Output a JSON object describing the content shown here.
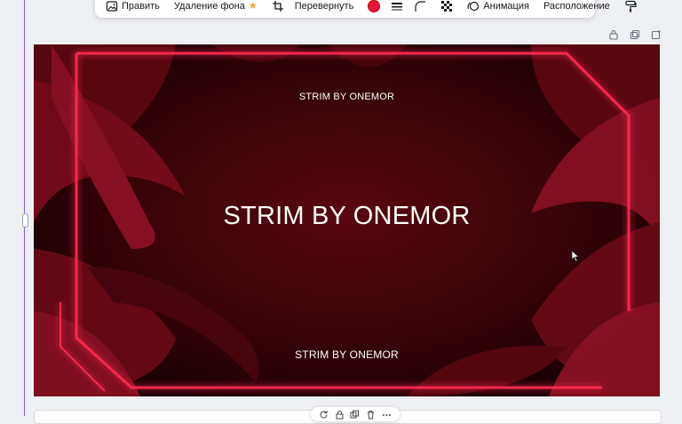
{
  "toolbar": {
    "edit_label": "Править",
    "bg_remove_label": "Удаление фона",
    "flip_label": "Перевернуть",
    "animation_label": "Анимация",
    "position_label": "Расположение",
    "selected_color": "#e8163c"
  },
  "design": {
    "top_text": "STRIM BY ONEMOR",
    "main_text": "STRIM BY ONEMOR",
    "bottom_text": "STRIM BY ONEMOR"
  },
  "colors": {
    "neon": "#ff2a4d",
    "selection": "#8b5cf6"
  }
}
